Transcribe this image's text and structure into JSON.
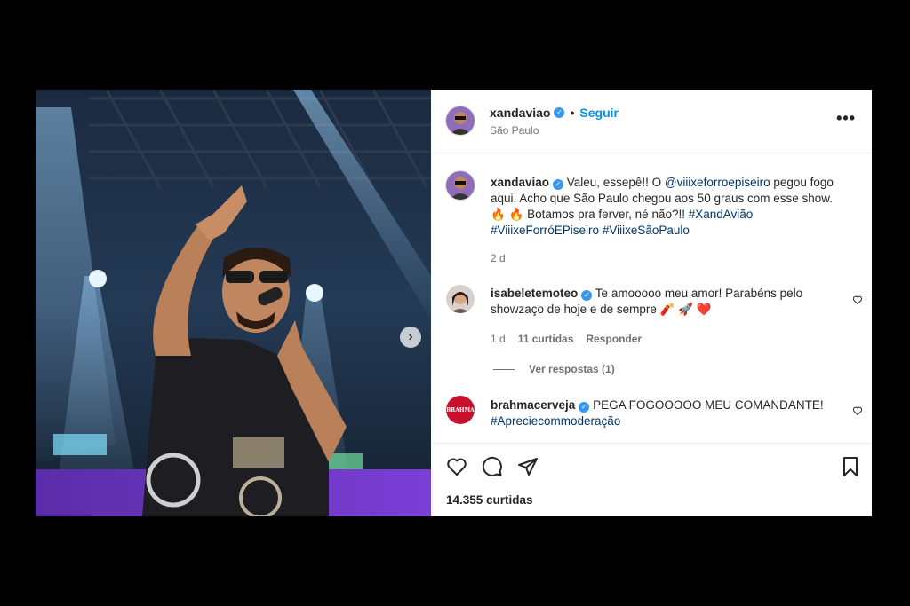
{
  "post": {
    "username": "xandaviao",
    "follow_label": "Seguir",
    "separator": "•",
    "location": "São Paulo",
    "more_label": "•••",
    "likes": "14.355 curtidas"
  },
  "caption": {
    "username": "xandaviao",
    "t1": " Valeu, essepê!! O ",
    "mention": "@viiixeforroepiseiro",
    "t2": " pegou fogo aqui. Acho que São Paulo chegou aos 50 graus com esse show. 🔥 🔥 Botamos pra ferver, né não?!! ",
    "tag1": "#XandAvião",
    "tag2": "#ViiixeForróEPiseiro",
    "tag3": "#ViiixeSãoPaulo",
    "time": "2 d"
  },
  "comments": [
    {
      "username": "isabeletemoteo",
      "text": " Te amooooo meu amor! Parabéns pelo showzaço de hoje e de sempre 🧨 🚀 ❤️",
      "time": "1 d",
      "likes": "11 curtidas",
      "reply": "Responder",
      "view_replies": "Ver respostas (1)"
    },
    {
      "username": "brahmacerveja",
      "text": " PEGA FOGOOOOO MEU COMANDANTE!",
      "tag": "#Apreciecommoderação",
      "avatar_text": "BRAHMA"
    }
  ],
  "colors": {
    "link": "#0095f6",
    "verified": "#3897f0",
    "hashtag": "#00376b",
    "brahma_red": "#c8102e"
  },
  "icons": [
    "heart-icon",
    "comment-icon",
    "share-icon",
    "bookmark-icon",
    "more-icon",
    "chevron-right-icon",
    "verified-icon"
  ]
}
